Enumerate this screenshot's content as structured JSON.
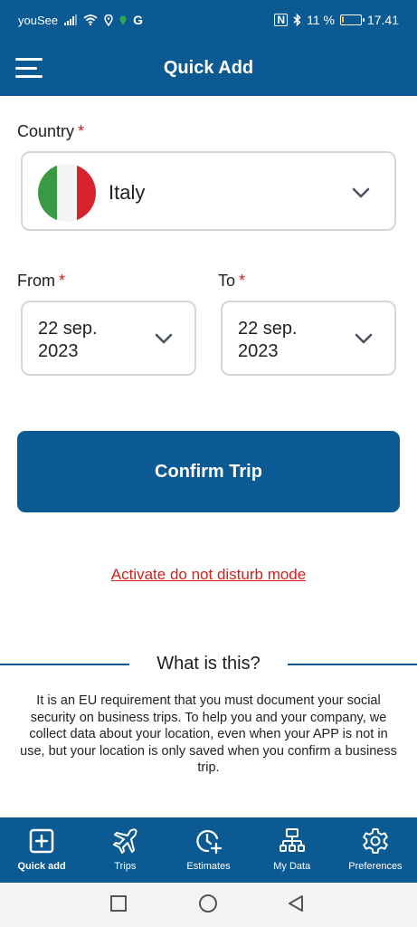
{
  "status_bar": {
    "carrier": "youSee",
    "battery_text": "11 %",
    "battery_level": 0.11,
    "time": "17.41",
    "icons": [
      "signal-icon",
      "wifi-icon",
      "location-icon",
      "google-icon",
      "nfc-icon",
      "bluetooth-icon",
      "battery-icon"
    ]
  },
  "app_bar": {
    "title": "Quick Add",
    "menu_icon": "hamburger-menu-icon"
  },
  "form": {
    "country_label": "Country",
    "required_mark": "*",
    "country_value": "Italy",
    "country_flag_colors": [
      "#3a9a43",
      "#f4f4f4",
      "#d7232e"
    ],
    "from_label": "From",
    "from_value_line1": "22 sep.",
    "from_value_line2": "2023",
    "to_label": "To",
    "to_value_line1": "22 sep.",
    "to_value_line2": "2023"
  },
  "confirm_button_label": "Confirm Trip",
  "dnd_link_text": "Activate do not disturb mode",
  "info": {
    "title": "What is this?",
    "text": "It is an EU requirement that you must document your social security on business trips. To help you and your company, we collect data about your location, even when your APP is not in use, but your location is only saved when you confirm a business trip."
  },
  "bottom_nav": {
    "items": [
      {
        "label": "Quick add",
        "icon": "plus-square-icon",
        "active": true
      },
      {
        "label": "Trips",
        "icon": "airplane-icon",
        "active": false
      },
      {
        "label": "Estimates",
        "icon": "clock-plus-icon",
        "active": false
      },
      {
        "label": "My Data",
        "icon": "data-tree-icon",
        "active": false
      },
      {
        "label": "Preferences",
        "icon": "gear-icon",
        "active": false
      }
    ]
  },
  "colors": {
    "primary": "#0b5a94",
    "required": "#d0221c",
    "link": "#d0221c",
    "border": "#d6d6d6"
  }
}
